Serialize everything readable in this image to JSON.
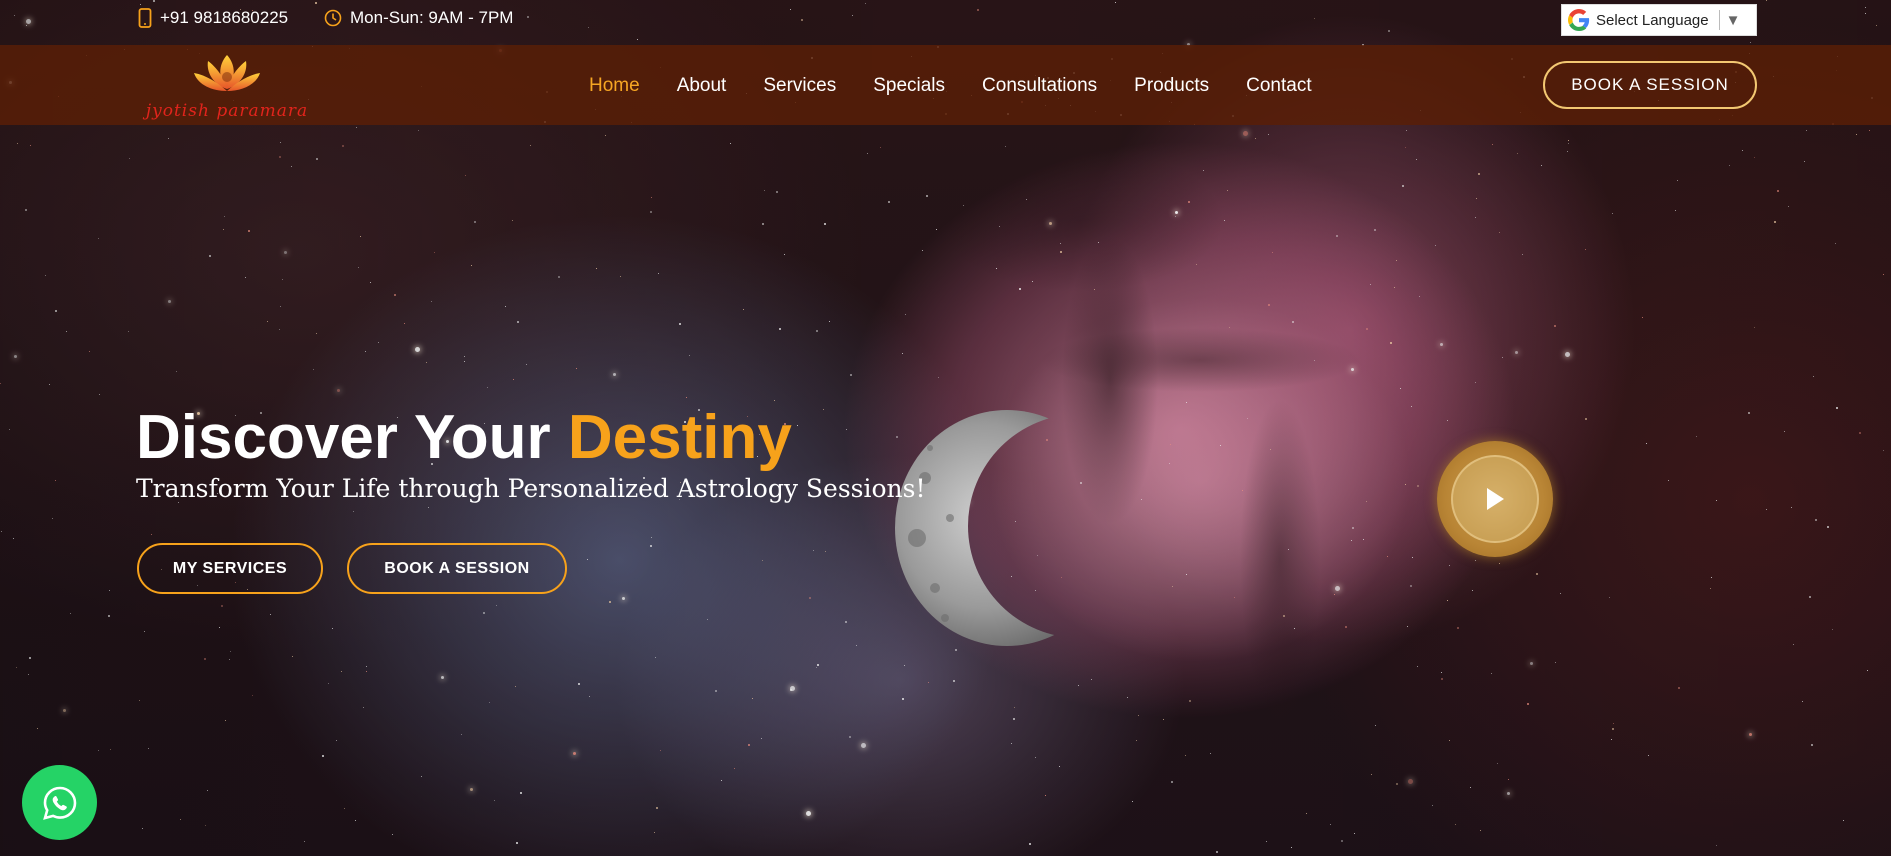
{
  "topbar": {
    "phone": "+91 9818680225",
    "hours": "Mon-Sun: 9AM - 7PM",
    "language_select": "Select Language"
  },
  "brand": {
    "name": "jyotish paramara"
  },
  "nav": {
    "items": [
      {
        "label": "Home",
        "active": true
      },
      {
        "label": "About"
      },
      {
        "label": "Services"
      },
      {
        "label": "Specials"
      },
      {
        "label": "Consultations"
      },
      {
        "label": "Products"
      },
      {
        "label": "Contact"
      }
    ],
    "book_button": "BOOK A SESSION"
  },
  "hero": {
    "title_main": "Discover Your",
    "title_accent": "Destiny",
    "subtitle": "Transform Your Life through Personalized Astrology Sessions!",
    "btn_services": "MY SERVICES",
    "btn_book": "BOOK A SESSION"
  },
  "colors": {
    "accent": "#f7a21b",
    "nav_bg": "#5a1e06",
    "whatsapp": "#25d366"
  },
  "icons": {
    "phone": "mobile-phone-icon",
    "hours": "clock-icon",
    "language": "google-g-icon",
    "play": "play-icon",
    "whatsapp": "whatsapp-icon"
  }
}
